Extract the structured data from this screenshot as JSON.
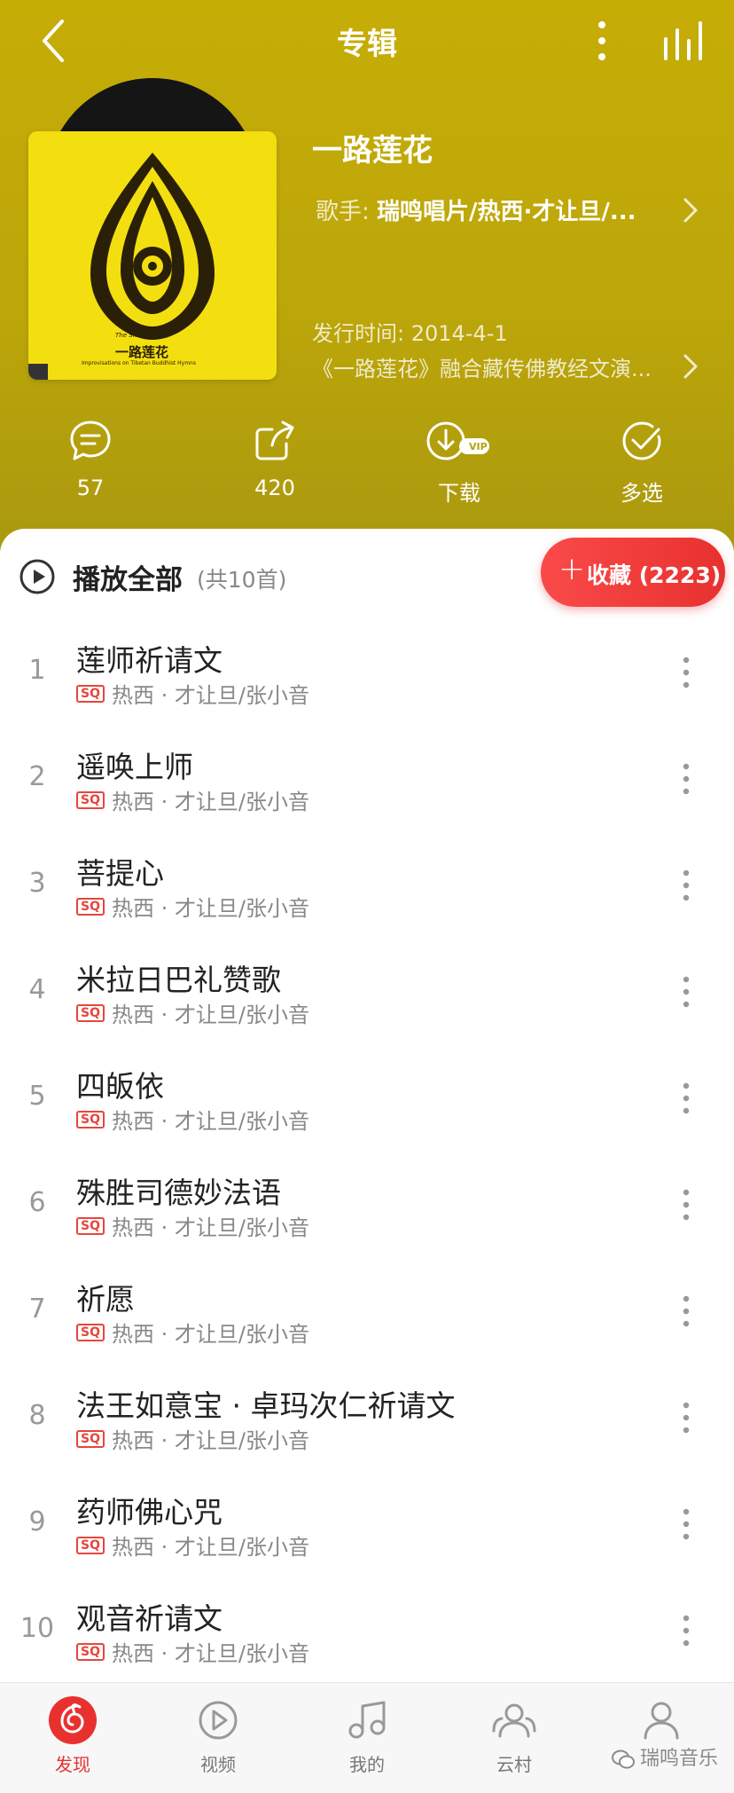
{
  "header": {
    "title": "专辑"
  },
  "album": {
    "name": "一路莲花",
    "artist_prefix": "歌手: ",
    "artists": "瑞鸣唱片/热西·才让旦/...",
    "release": "发行时间: 2014-4-1",
    "description": "《一路莲花》融合藏传佛教经文演...",
    "cover": {
      "title_cn": "一路莲花",
      "title_en": "The Snow Lotus",
      "subtitle_en": "Improvisations on Tibetan Buddhist Hymns",
      "accent_color": "#f3df10"
    }
  },
  "actions": {
    "comment_count": "57",
    "share_count": "420",
    "download_label": "下载",
    "vip_badge": "VIP",
    "multi_select_label": "多选"
  },
  "playlist": {
    "play_all_label": "播放全部",
    "count_label": "(共10首)",
    "collect_label": "收藏 (2223)"
  },
  "tracks": [
    {
      "num": "1",
      "title": "莲师祈请文",
      "quality": "SQ",
      "artist": "热西 · 才让旦/张小音"
    },
    {
      "num": "2",
      "title": "遥唤上师",
      "quality": "SQ",
      "artist": "热西 · 才让旦/张小音"
    },
    {
      "num": "3",
      "title": "菩提心",
      "quality": "SQ",
      "artist": "热西 · 才让旦/张小音"
    },
    {
      "num": "4",
      "title": "米拉日巴礼赞歌",
      "quality": "SQ",
      "artist": "热西 · 才让旦/张小音"
    },
    {
      "num": "5",
      "title": " 四皈依",
      "quality": "SQ",
      "artist": "热西 · 才让旦/张小音"
    },
    {
      "num": "6",
      "title": "殊胜司德妙法语",
      "quality": "SQ",
      "artist": "热西 · 才让旦/张小音"
    },
    {
      "num": "7",
      "title": "祈愿",
      "quality": "SQ",
      "artist": "热西 · 才让旦/张小音"
    },
    {
      "num": "8",
      "title": "法王如意宝 · 卓玛次仁祈请文",
      "quality": "SQ",
      "artist": "热西 · 才让旦/张小音"
    },
    {
      "num": "9",
      "title": "药师佛心咒",
      "quality": "SQ",
      "artist": "热西 · 才让旦/张小音"
    },
    {
      "num": "10",
      "title": "观音祈请文",
      "quality": "SQ",
      "artist": "热西 · 才让旦/张小音"
    }
  ],
  "nav": {
    "items": [
      {
        "label": "发现",
        "icon": "discover-icon",
        "active": true
      },
      {
        "label": "视频",
        "icon": "video-icon"
      },
      {
        "label": "我的",
        "icon": "music-note-icon"
      },
      {
        "label": "云村",
        "icon": "friends-icon"
      },
      {
        "label": "账号",
        "icon": "account-icon"
      }
    ]
  },
  "watermark": "瑞鸣音乐",
  "colors": {
    "header": "#c6ad06",
    "accent_red": "#e8312f"
  }
}
